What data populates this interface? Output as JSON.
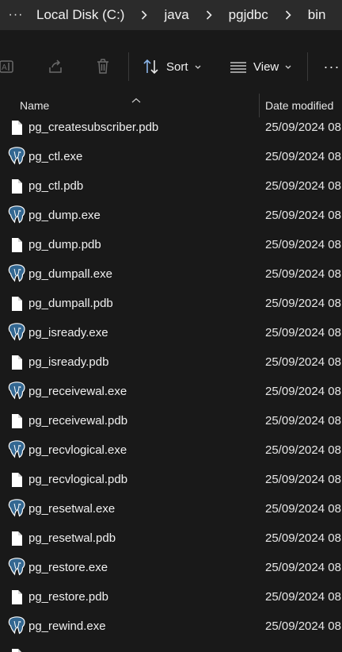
{
  "breadcrumb": {
    "more": "···",
    "items": [
      "Local Disk (C:)",
      "java",
      "pgjdbc",
      "bin"
    ]
  },
  "toolbar": {
    "sort_label": "Sort",
    "view_label": "View",
    "more_label": "···"
  },
  "columns": {
    "name": "Name",
    "date_modified": "Date modified"
  },
  "files": [
    {
      "name": "pg_createsubscriber.pdb",
      "date": "25/09/2024 08",
      "icon": "file-icon"
    },
    {
      "name": "pg_ctl.exe",
      "date": "25/09/2024 08",
      "icon": "postgres-elephant-icon"
    },
    {
      "name": "pg_ctl.pdb",
      "date": "25/09/2024 08",
      "icon": "file-icon"
    },
    {
      "name": "pg_dump.exe",
      "date": "25/09/2024 08",
      "icon": "postgres-elephant-icon"
    },
    {
      "name": "pg_dump.pdb",
      "date": "25/09/2024 08",
      "icon": "file-icon"
    },
    {
      "name": "pg_dumpall.exe",
      "date": "25/09/2024 08",
      "icon": "postgres-elephant-icon"
    },
    {
      "name": "pg_dumpall.pdb",
      "date": "25/09/2024 08",
      "icon": "file-icon"
    },
    {
      "name": "pg_isready.exe",
      "date": "25/09/2024 08",
      "icon": "postgres-elephant-icon"
    },
    {
      "name": "pg_isready.pdb",
      "date": "25/09/2024 08",
      "icon": "file-icon"
    },
    {
      "name": "pg_receivewal.exe",
      "date": "25/09/2024 08",
      "icon": "postgres-elephant-icon"
    },
    {
      "name": "pg_receivewal.pdb",
      "date": "25/09/2024 08",
      "icon": "file-icon"
    },
    {
      "name": "pg_recvlogical.exe",
      "date": "25/09/2024 08",
      "icon": "postgres-elephant-icon"
    },
    {
      "name": "pg_recvlogical.pdb",
      "date": "25/09/2024 08",
      "icon": "file-icon"
    },
    {
      "name": "pg_resetwal.exe",
      "date": "25/09/2024 08",
      "icon": "postgres-elephant-icon"
    },
    {
      "name": "pg_resetwal.pdb",
      "date": "25/09/2024 08",
      "icon": "file-icon"
    },
    {
      "name": "pg_restore.exe",
      "date": "25/09/2024 08",
      "icon": "postgres-elephant-icon"
    },
    {
      "name": "pg_restore.pdb",
      "date": "25/09/2024 08",
      "icon": "file-icon"
    },
    {
      "name": "pg_rewind.exe",
      "date": "25/09/2024 08",
      "icon": "postgres-elephant-icon"
    },
    {
      "name": "",
      "date": "",
      "icon": "file-icon"
    }
  ],
  "colors": {
    "background": "#191919",
    "address_bar": "#2b2b2b",
    "elephant_blue": "#336791"
  }
}
